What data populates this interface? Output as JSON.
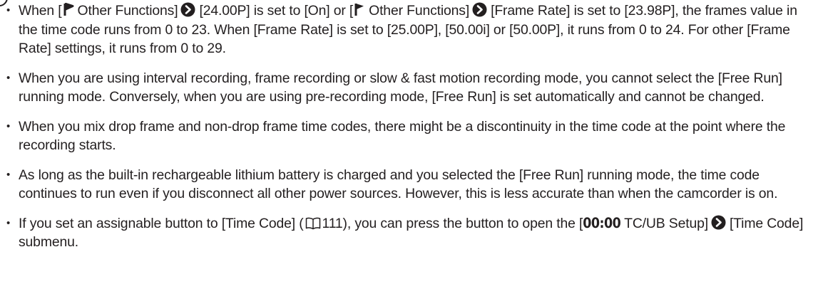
{
  "notes": [
    {
      "p1": "When [",
      "p2": "Other Functions]",
      "p3": "[24.00P] is set to [On] or [",
      "p4": "Other Functions]",
      "p5": "[Frame Rate] is set to [23.98P], the frames value in the time code runs from 0 to 23. When [Frame Rate] is set to [25.00P], [50.00i] or [50.00P], it runs from 0 to 24. For other [Frame Rate] settings, it runs from 0 to 29."
    },
    {
      "text": "When you are using interval recording, frame recording or slow & fast motion recording mode, you cannot select the [Free Run] running mode. Conversely, when you are using pre-recording mode, [Free Run] is set automatically and cannot be changed."
    },
    {
      "text": "When you mix drop frame and non-drop frame time codes, there might be a discontinuity in the time code at the point where the recording starts."
    },
    {
      "text": "As long as the built-in rechargeable lithium battery is charged and you selected the [Free Run] running mode, the time code continues to run even if you disconnect all other power sources. However, this is less accurate than when the camcorder is on."
    },
    {
      "p1": "If you set an assignable button to [Time Code] (",
      "page_ref": "111",
      "p2": "), you can press the button to open the [",
      "tc": "00:00",
      "p3": "TC/UB Setup]",
      "p4": "[Time Code] submenu."
    }
  ],
  "icons": {
    "note_marker": "note-icon",
    "menu": "wrench-menu-icon",
    "arrow": "menu-arrow-icon",
    "page_ref": "book-reference-icon"
  },
  "colors": {
    "text": "#231f20"
  }
}
